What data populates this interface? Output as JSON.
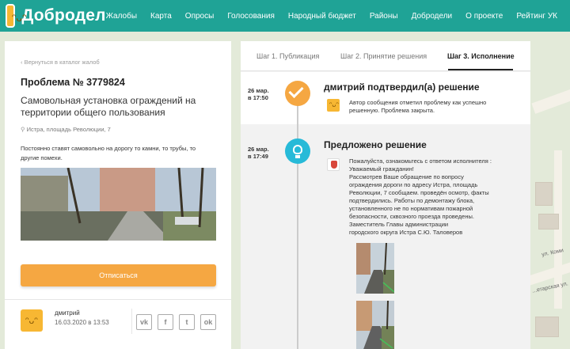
{
  "header": {
    "brand": "Добродел",
    "nav": [
      "Жалобы",
      "Карта",
      "Опросы",
      "Голосования",
      "Народный бюджет",
      "Районы",
      "Добродели",
      "О проекте",
      "Рейтинг УК"
    ]
  },
  "map": {
    "labels": [
      "ул. Коми",
      "...етарская ул."
    ]
  },
  "left": {
    "back_link": "‹  Вернуться в каталог жалоб",
    "problem_no": "Проблема № 3779824",
    "problem_title": "Самовольная установка ограждений на территории общего пользования",
    "address": "Истра, площадь Революции, 7",
    "description": "Постоянно ставят самовольно на дорогу то камни, то трубы, то другие помехи.",
    "unsubscribe_label": "Отписаться",
    "author": {
      "name": "дмитрий",
      "date": "16.03.2020 в 13:53"
    },
    "share": [
      "vk",
      "f",
      "t",
      "ok"
    ]
  },
  "right": {
    "tabs": [
      {
        "label": "Шаг 1. Публикация",
        "active": false
      },
      {
        "label": "Шаг 2. Принятие решения",
        "active": false
      },
      {
        "label": "Шаг 3. Исполнение",
        "active": true
      }
    ],
    "events": [
      {
        "date_line1": "26 мар.",
        "date_line2": "в 17:50",
        "title": "дмитрий подтвердил(а) решение",
        "message_lines": [
          "Автор сообщения отметил проблему как успешно",
          "решенную. Проблема закрыта."
        ]
      },
      {
        "date_line1": "26 мар.",
        "date_line2": "в 17:49",
        "title": "Предложено решение",
        "message_lines": [
          "Пожалуйста, ознакомьтесь с ответом исполнителя :",
          "Уважаемый гражданин!",
          "Рассмотрев Ваше обращение по вопросу",
          "ограждения дороги по адресу Истра, площадь",
          "Революции, 7 сообщаем.   проведён осмотр, факты",
          "подтвердились. Работы по демонтажу блока,",
          "установленного не по нормативам  пожарной",
          "безопасности, сквозного проезда проведены.",
          "Заместитель Главы администрации",
          "городского округа Истра С.Ю. Таловеров"
        ]
      }
    ]
  },
  "colors": {
    "header": "#1fa396",
    "accent": "#f5a742",
    "info": "#27bad8"
  }
}
